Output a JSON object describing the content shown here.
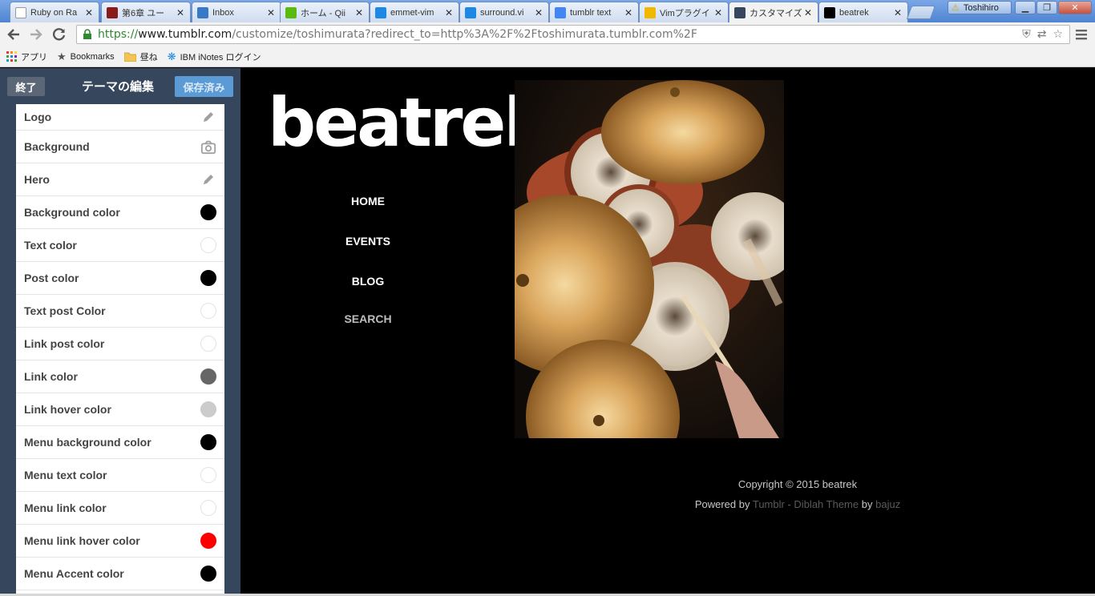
{
  "browser": {
    "tabs": [
      {
        "title": "Ruby on Ra",
        "favicon": "document-icon",
        "fav_color": "#ffffff"
      },
      {
        "title": "第6章 ユー",
        "favicon": "book-icon",
        "fav_color": "#8b1a1a"
      },
      {
        "title": "Inbox",
        "favicon": "grid-icon",
        "fav_color": "#3a78c8"
      },
      {
        "title": "ホーム - Qii",
        "favicon": "qiita-icon",
        "fav_color": "#59bb0c"
      },
      {
        "title": "emmet-vim",
        "favicon": "m-icon",
        "fav_color": "#1e88e5"
      },
      {
        "title": "surround.vi",
        "favicon": "m-icon",
        "fav_color": "#1e88e5"
      },
      {
        "title": "tumblr text",
        "favicon": "google-icon",
        "fav_color": "#4285f4"
      },
      {
        "title": "Vimプラグイ",
        "favicon": "face-icon",
        "fav_color": "#f2b800"
      },
      {
        "title": "カスタマイズ",
        "favicon": "tumblr-icon",
        "fav_color": "#36465d"
      },
      {
        "title": "beatrek",
        "favicon": "beatrek-icon",
        "fav_color": "#000000"
      }
    ],
    "active_tab_index": 8,
    "profile_name": "Toshihiro",
    "url": {
      "scheme": "https://",
      "host": "www.tumblr.com",
      "path": "/customize/toshimurata?redirect_to=http%3A%2F%2Ftoshimurata.tumblr.com%2F"
    },
    "bookmarks": [
      {
        "label": "アプリ",
        "icon": "apps-grid-icon"
      },
      {
        "label": "Bookmarks",
        "icon": "star-icon"
      },
      {
        "label": "昼ね",
        "icon": "folder-icon"
      },
      {
        "label": "IBM iNotes ログイン",
        "icon": "ibm-icon"
      }
    ]
  },
  "sidebar": {
    "exit_label": "終了",
    "title": "テーマの編集",
    "saved_label": "保存済み",
    "options": [
      {
        "label": "Logo",
        "kind": "edit",
        "icon": "pencil-icon"
      },
      {
        "label": "Background",
        "kind": "photo",
        "icon": "camera-icon"
      },
      {
        "label": "Hero",
        "kind": "edit",
        "icon": "pencil-icon"
      },
      {
        "label": "Background color",
        "kind": "color",
        "color": "#000000"
      },
      {
        "label": "Text color",
        "kind": "color",
        "color": "#ffffff"
      },
      {
        "label": "Post color",
        "kind": "color",
        "color": "#000000"
      },
      {
        "label": "Text post Color",
        "kind": "color",
        "color": "#ffffff"
      },
      {
        "label": "Link post color",
        "kind": "color",
        "color": "#ffffff"
      },
      {
        "label": "Link color",
        "kind": "color",
        "color": "#666666"
      },
      {
        "label": "Link hover color",
        "kind": "color",
        "color": "#cccccc"
      },
      {
        "label": "Menu background color",
        "kind": "color",
        "color": "#000000"
      },
      {
        "label": "Menu text color",
        "kind": "color",
        "color": "#ffffff"
      },
      {
        "label": "Menu link color",
        "kind": "color",
        "color": "#ffffff"
      },
      {
        "label": "Menu link hover color",
        "kind": "color",
        "color": "#ff0000"
      },
      {
        "label": "Menu Accent color",
        "kind": "color",
        "color": "#000000"
      }
    ]
  },
  "preview": {
    "logo_text": "beatrek",
    "menu": [
      "HOME",
      "EVENTS",
      "BLOG",
      "SEARCH"
    ],
    "copyright": "Copyright © 2015 beatrek",
    "powered_prefix": "Powered by",
    "powered_tumblr": "Tumblr",
    "powered_sep": "-",
    "powered_theme": "Diblah Theme",
    "powered_by": "by",
    "powered_author": "bajuz"
  }
}
